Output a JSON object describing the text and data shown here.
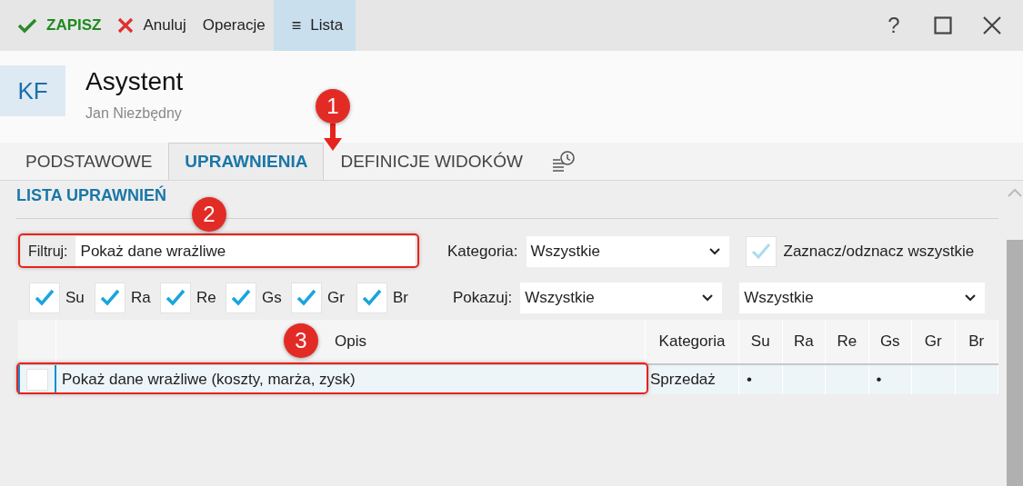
{
  "toolbar": [
    {
      "kind": "save",
      "label": "ZAPISZ",
      "selected": false
    },
    {
      "kind": "cancel",
      "label": "Anuluj",
      "selected": false
    },
    {
      "kind": "plain",
      "label": "Operacje",
      "selected": false
    },
    {
      "kind": "menu",
      "icon": "≡",
      "label": "Lista",
      "selected": true
    }
  ],
  "window_buttons": [
    {
      "kind": "help",
      "label": "?"
    },
    {
      "kind": "maximize"
    },
    {
      "kind": "close"
    }
  ],
  "header": {
    "initials": "KF",
    "title": "Asystent",
    "subtitle": "Jan Niezbędny"
  },
  "tabs": [
    {
      "label": "PODSTAWOWE",
      "selected": false
    },
    {
      "label": "UPRAWNIENIA",
      "selected": true
    },
    {
      "label": "DEFINICJE WIDOKÓW",
      "selected": false
    }
  ],
  "section_title": "LISTA UPRAWNIEŃ",
  "filter": {
    "label": "Filtruj:",
    "value": "Pokaż dane wrażliwe"
  },
  "category": {
    "label": "Kategoria:",
    "value": "Wszystkie"
  },
  "select_all": {
    "label": "Zaznacz/odznacz wszystkie",
    "checked": true
  },
  "role_filters": [
    {
      "label": "Su",
      "checked": true
    },
    {
      "label": "Ra",
      "checked": true
    },
    {
      "label": "Re",
      "checked": true
    },
    {
      "label": "Gs",
      "checked": true
    },
    {
      "label": "Gr",
      "checked": true
    },
    {
      "label": "Br",
      "checked": true
    }
  ],
  "show": {
    "label": "Pokazuj:",
    "value": "Wszystkie",
    "second_value": "Wszystkie"
  },
  "table": {
    "columns": [
      "Opis",
      "Kategoria",
      "Su",
      "Ra",
      "Re",
      "Gs",
      "Gr",
      "Br"
    ],
    "rows": [
      {
        "checked": false,
        "selected": true,
        "description": "Pokaż dane wrażliwe (koszty, marża, zysk)",
        "category": "Sprzedaż",
        "flag_mark": "•",
        "flags": [
          true,
          false,
          false,
          true,
          false,
          false
        ]
      }
    ]
  },
  "annotations": [
    {
      "label": "1"
    },
    {
      "label": "2"
    },
    {
      "label": "3"
    }
  ]
}
